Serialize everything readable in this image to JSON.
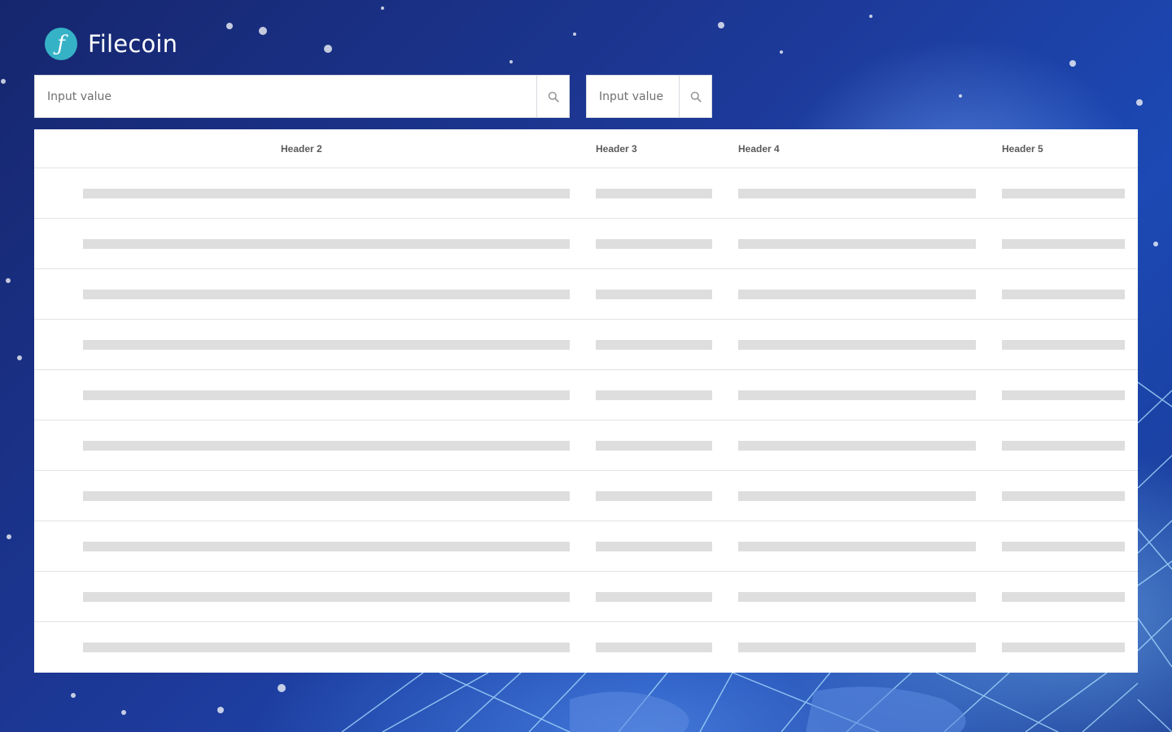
{
  "app": {
    "name": "Filecoin",
    "logo_glyph": "ƒ",
    "logo_color": "#36b2c6"
  },
  "search_main": {
    "placeholder": "Input value",
    "icon": "search-icon"
  },
  "search_secondary": {
    "placeholder": "Input value",
    "icon": "search-icon"
  },
  "table": {
    "headers": [
      "Header 2",
      "Header 3",
      "Header 4",
      "Header 5"
    ],
    "row_count": 10,
    "rows_state": "loading-skeleton"
  },
  "colors": {
    "background": "#1d3a9a",
    "card": "#ffffff",
    "skeleton": "#dedede",
    "header_text": "#5a5a5a"
  }
}
